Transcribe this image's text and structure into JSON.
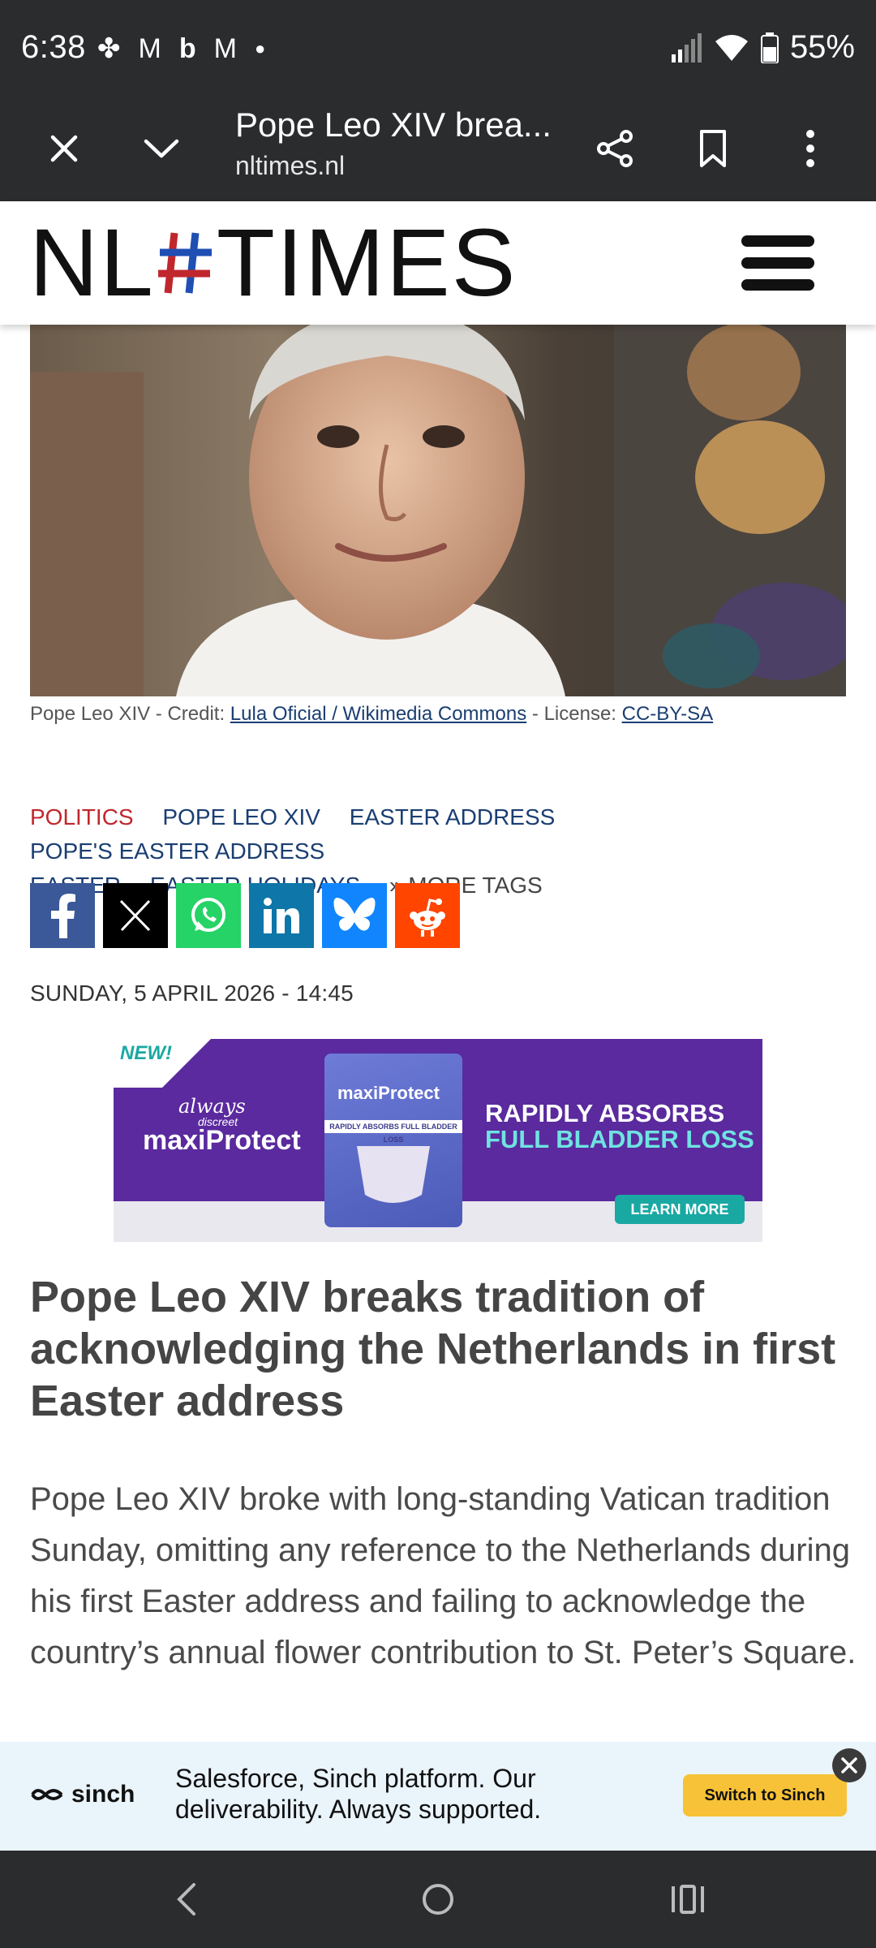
{
  "status_bar": {
    "time": "6:38",
    "battery_percent": "55%",
    "notification_icons": [
      "pinwheel-icon",
      "gmail-icon",
      "bing-icon",
      "gmail-icon",
      "dot-icon"
    ]
  },
  "browser": {
    "tab_title": "Pope Leo XIV brea...",
    "url": "nltimes.nl"
  },
  "site": {
    "logo_left": "NL",
    "logo_hash": "#",
    "logo_right": "TIMES"
  },
  "hero": {
    "caption_prefix": "Pope Leo XIV - Credit: ",
    "caption_credit_link": "Lula Oficial / Wikimedia Commons",
    "caption_middle": " - License: ",
    "caption_license_link": "CC-BY-SA"
  },
  "tags": {
    "items": [
      "POLITICS",
      "POPE LEO XIV",
      "EASTER ADDRESS",
      "POPE'S EASTER ADDRESS",
      "EASTER",
      "EASTER HOLIDAYS"
    ],
    "more": "» MORE TAGS"
  },
  "share": {
    "colors": {
      "facebook": "#3b5998",
      "x": "#000000",
      "whatsapp": "#25d366",
      "linkedin": "#0e76a8",
      "bluesky": "#1185fe",
      "reddit": "#ff4500"
    }
  },
  "article": {
    "date": "SUNDAY, 5 APRIL 2026 - 14:45",
    "headline": "Pope Leo XIV breaks tradition of acknowledging the Netherlands in first Easter address",
    "lede": "Pope Leo XIV broke with long-standing Vatican tradition Sunday, omitting any reference to the Netherlands during his first Easter address and failing to acknowledge the country’s annual flower contribution to St. Peter’s Square."
  },
  "ad": {
    "badge": "NEW!",
    "brand_always": "always",
    "brand_discreet": "discreet",
    "brand_maxi": "maxiProtect",
    "product_label": "maxiProtect",
    "product_strip": "RAPIDLY ABSORBS FULL BLADDER LOSS",
    "headline_line1": "RAPIDLY ABSORBS",
    "headline_line2": "FULL BLADDER LOSS",
    "cta": "LEARN MORE"
  },
  "bottom_ad": {
    "brand": "sinch",
    "text": "Salesforce, Sinch platform. Our deliverability. Always supported.",
    "cta": "Switch to Sinch"
  }
}
